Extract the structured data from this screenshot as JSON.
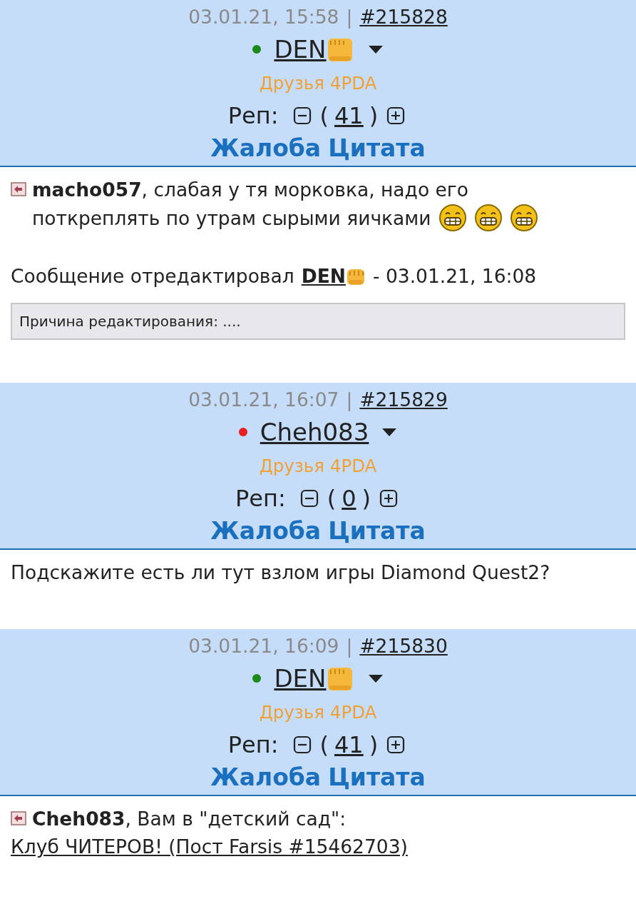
{
  "posts": [
    {
      "date": "03.01.21, 15:58",
      "separator": "|",
      "number": "#215828",
      "online": true,
      "nick": "DEN",
      "fist_emoji": true,
      "group": "Друзья 4PDA",
      "rep_label": "Реп:",
      "rep_open": "(",
      "rep_value": "41",
      "rep_close": ")",
      "actions": [
        "Жалоба",
        "Цитата"
      ],
      "body": [
        {
          "kind": "reply",
          "text": "**macho057**, слабая у тя морковка, надо его поткреплять по утрам сырыми яичками",
          "smileys": [
            {
              "kind": "grin"
            },
            {
              "kind": "grin"
            },
            {
              "kind": "grin"
            }
          ]
        },
        {
          "kind": "edit",
          "label": "Сообщение отредактировал",
          "editor": "DEN",
          "fist_emoji": true,
          "time": "- 03.01.21, 16:08"
        },
        {
          "kind": "reason",
          "text": "Причина редактирования: ...."
        }
      ]
    },
    {
      "date": "03.01.21, 16:07",
      "separator": "|",
      "number": "#215829",
      "online": false,
      "nick": "Cheh083",
      "fist_emoji": false,
      "group": "Друзья 4PDA",
      "rep_label": "Реп:",
      "rep_open": "(",
      "rep_value": "0",
      "rep_close": ")",
      "actions": [
        "Жалоба",
        "Цитата"
      ],
      "body": [
        {
          "kind": "text",
          "text": "Подскажите есть ли тут взлом игры Diamond Quest2?"
        }
      ]
    },
    {
      "date": "03.01.21, 16:09",
      "separator": "|",
      "number": "#215830",
      "online": true,
      "nick": "DEN",
      "fist_emoji": true,
      "group": "Друзья 4PDA",
      "rep_label": "Реп:",
      "rep_open": "(",
      "rep_value": "41",
      "rep_close": ")",
      "actions": [
        "Жалоба",
        "Цитата"
      ],
      "body": [
        {
          "kind": "reply",
          "text": "**Cheh083**, Вам в \"детский сад\":"
        },
        {
          "kind": "link",
          "text": "Клуб ЧИТЕРОВ! (Пост Farsis #15462703)"
        }
      ]
    }
  ]
}
